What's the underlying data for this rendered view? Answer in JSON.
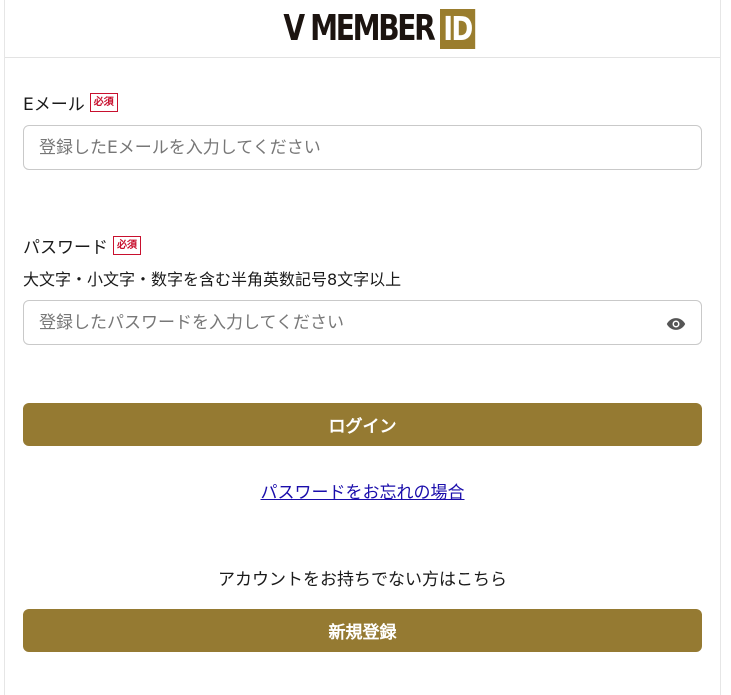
{
  "header": {
    "logo_text": "V MEMBER",
    "logo_badge": "ID"
  },
  "email": {
    "label": "Eメール",
    "required": "必須",
    "placeholder": "登録したEメールを入力してください",
    "value": ""
  },
  "password": {
    "label": "パスワード",
    "required": "必須",
    "hint": "大文字・小文字・数字を含む半角英数記号8文字以上",
    "placeholder": "登録したパスワードを入力してください",
    "value": "",
    "toggle_icon": "eye-icon"
  },
  "login_button": "ログイン",
  "forgot_link": "パスワードをお忘れの場合",
  "signup_note": "アカウントをお持ちでない方はこちら",
  "signup_button": "新規登録",
  "colors": {
    "brand_gold": "#957a32",
    "required_red": "#c8102e",
    "link_blue": "#1a0dab"
  }
}
